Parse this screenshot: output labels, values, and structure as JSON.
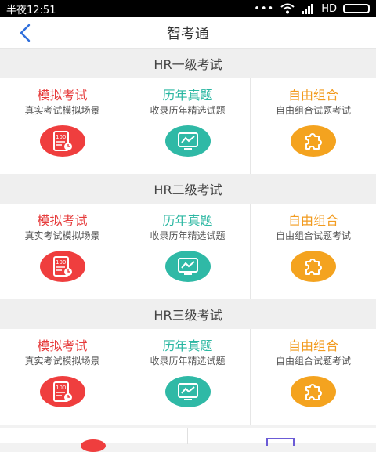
{
  "status": {
    "time": "半夜12:51",
    "dots": "•••",
    "network": "HD"
  },
  "header": {
    "title": "智考通"
  },
  "sections": [
    {
      "title": "HR一级考试",
      "items": [
        {
          "name": "模拟考试",
          "desc": "真实考试模拟场景",
          "icon": "exam-paper-icon"
        },
        {
          "name": "历年真题",
          "desc": "收录历年精选试题",
          "icon": "chart-monitor-icon"
        },
        {
          "name": "自由组合",
          "desc": "自由组合试题考试",
          "icon": "puzzle-icon"
        }
      ]
    },
    {
      "title": "HR二级考试",
      "items": [
        {
          "name": "模拟考试",
          "desc": "真实考试模拟场景",
          "icon": "exam-paper-icon"
        },
        {
          "name": "历年真题",
          "desc": "收录历年精选试题",
          "icon": "chart-monitor-icon"
        },
        {
          "name": "自由组合",
          "desc": "自由组合试题考试",
          "icon": "puzzle-icon"
        }
      ]
    },
    {
      "title": "HR三级考试",
      "items": [
        {
          "name": "模拟考试",
          "desc": "真实考试模拟场景",
          "icon": "exam-paper-icon"
        },
        {
          "name": "历年真题",
          "desc": "收录历年精选试题",
          "icon": "chart-monitor-icon"
        },
        {
          "name": "自由组合",
          "desc": "自由组合试题考试",
          "icon": "puzzle-icon"
        }
      ]
    }
  ],
  "colors": {
    "red": "#ef3e3e",
    "teal": "#2fb9a6",
    "orange": "#f4a31f",
    "back_blue": "#2f6fdc"
  }
}
